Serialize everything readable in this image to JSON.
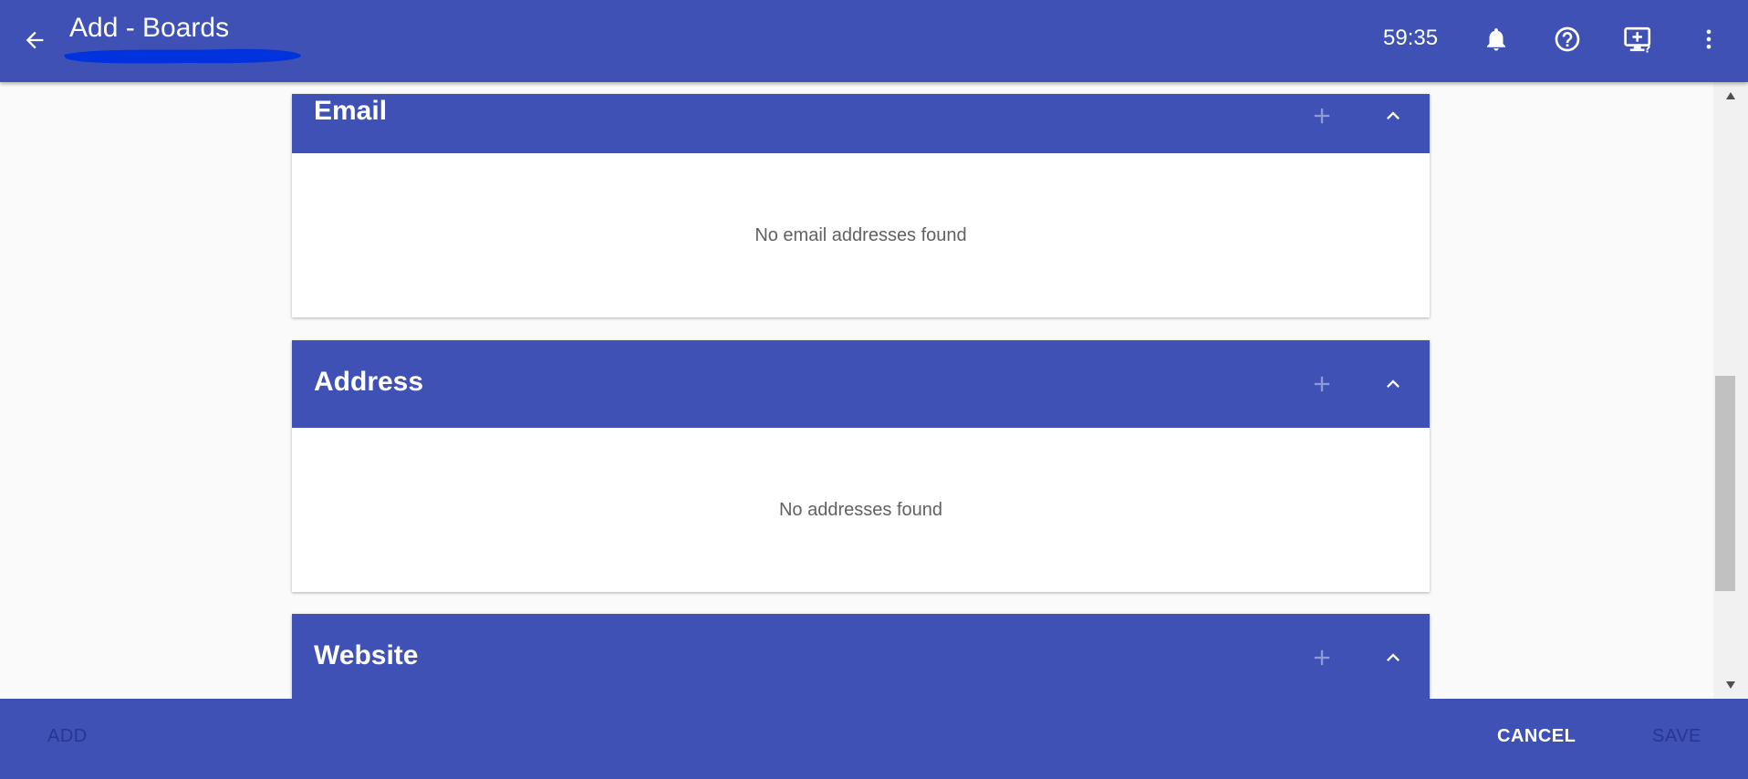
{
  "header": {
    "title": "Add - Boards",
    "timer": "59:35",
    "icons": [
      "arrow-back-icon",
      "bell-icon",
      "help-circle-icon",
      "monitor-help-icon",
      "more-vert-icon"
    ]
  },
  "sections": [
    {
      "title": "Email",
      "empty_message": "No email addresses found"
    },
    {
      "title": "Address",
      "empty_message": "No addresses found"
    },
    {
      "title": "Website",
      "empty_message": ""
    }
  ],
  "footer": {
    "add_label": "ADD",
    "cancel_label": "CANCEL",
    "save_label": "SAVE"
  },
  "colors": {
    "primary": "#3f51b5",
    "redaction": "#0033dd",
    "disabled_text": "#283593"
  }
}
